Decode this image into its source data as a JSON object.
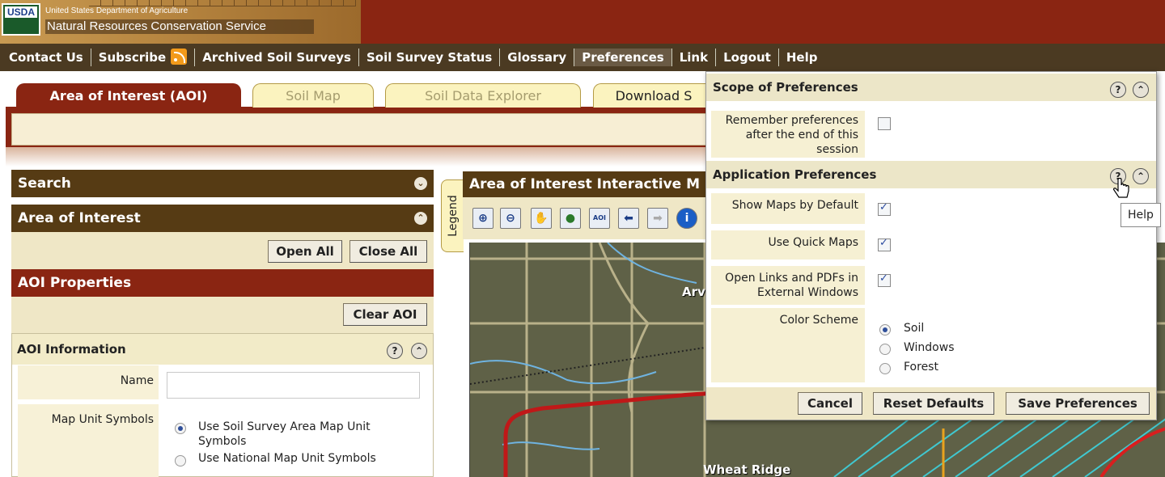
{
  "header": {
    "usda_badge": "USDA",
    "agency_line1": "United States Department of Agriculture",
    "agency_line2": "Natural Resources Conservation Service"
  },
  "nav": {
    "items": [
      "Contact Us",
      "Subscribe",
      "Archived Soil Surveys",
      "Soil Survey Status",
      "Glossary",
      "Preferences",
      "Link",
      "Logout",
      "Help"
    ],
    "active": "Preferences",
    "rss_icon": "rss-icon"
  },
  "tabs": [
    "Area of Interest (AOI)",
    "Soil Map",
    "Soil Data Explorer",
    "Download S"
  ],
  "left_panel": {
    "search": "Search",
    "area_of_interest": "Area of Interest",
    "open_all": "Open All",
    "close_all": "Close All",
    "aoi_properties": "AOI Properties",
    "clear_aoi": "Clear AOI",
    "aoi_information": "AOI Information",
    "name_label": "Name",
    "name_value": "",
    "map_unit_symbols_label": "Map Unit Symbols",
    "map_unit_options": [
      "Use Soil Survey Area Map Unit Symbols",
      "Use National Map Unit Symbols"
    ],
    "map_unit_selected": 0
  },
  "map": {
    "title": "Area of Interest Interactive M",
    "legend": "Legend",
    "labels": [
      "Arv",
      "Wheat Ridge"
    ],
    "tools": [
      "zoom-in-icon",
      "zoom-out-icon",
      "pan-icon",
      "globe-icon",
      "aoi-icon",
      "back-arrow-icon",
      "forward-arrow-icon",
      "info-icon"
    ],
    "aoi_tool_text": "AOI",
    "info_tool_text": "i"
  },
  "preferences": {
    "scope_title": "Scope of Preferences",
    "remember_label": "Remember preferences after the end of this session",
    "remember_checked": false,
    "app_title": "Application Preferences",
    "show_maps_label": "Show Maps by Default",
    "show_maps_checked": true,
    "quick_maps_label": "Use Quick Maps",
    "quick_maps_checked": true,
    "external_label": "Open Links and PDFs in External Windows",
    "external_checked": true,
    "color_scheme_label": "Color Scheme",
    "color_scheme_options": [
      "Soil",
      "Windows",
      "Forest"
    ],
    "color_scheme_selected": "Soil",
    "cancel": "Cancel",
    "reset_defaults": "Reset Defaults",
    "save_preferences": "Save Preferences",
    "tooltip": "Help"
  }
}
